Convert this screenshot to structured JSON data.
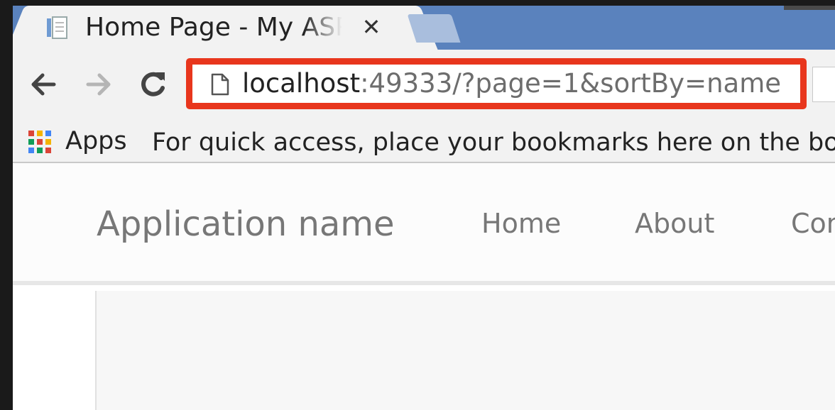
{
  "tab": {
    "title": "Home Page - My ASP.NET Application",
    "close_glyph": "✕",
    "favicon": "page-favicon-icon"
  },
  "toolbar": {
    "back_icon": "arrow-left-icon",
    "forward_icon": "arrow-right-icon",
    "reload_icon": "reload-icon",
    "url_host": "localhost",
    "url_rest": ":49333/?page=1&sortBy=name"
  },
  "bookmarks": {
    "apps_label": "Apps",
    "hint": "For quick access, place your bookmarks here on the bookmarks bar."
  },
  "site": {
    "brand": "Application name",
    "nav": [
      "Home",
      "About",
      "Contact"
    ]
  },
  "colors": {
    "tabstrip": "#5a82bd",
    "highlight": "#e8361d",
    "nav_text": "#777777"
  }
}
